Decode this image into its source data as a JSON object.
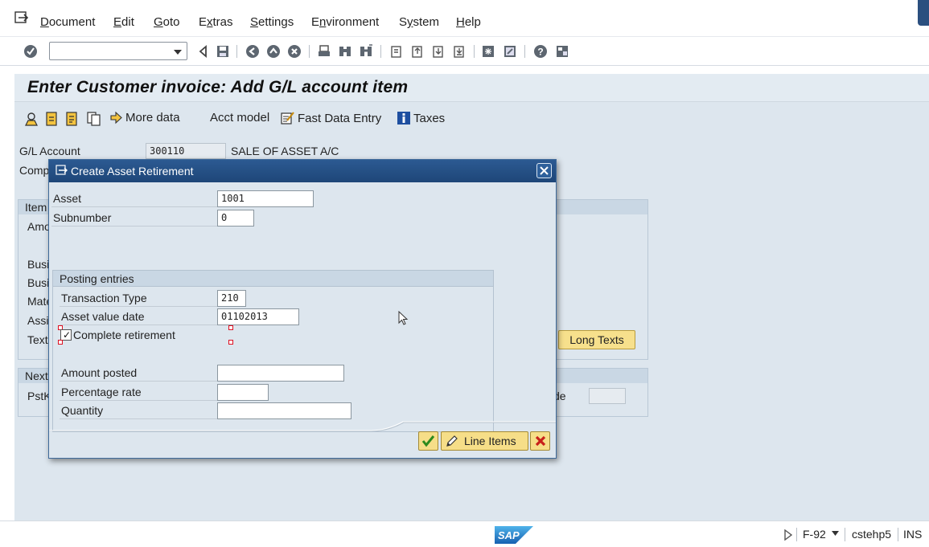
{
  "menubar": {
    "items": [
      "Document",
      "Edit",
      "Goto",
      "Extras",
      "Settings",
      "Environment",
      "System",
      "Help"
    ],
    "underline_chars": [
      "D",
      "E",
      "G",
      "x",
      "S",
      "n",
      "y",
      "H"
    ]
  },
  "toolbar": {
    "command_field_value": ""
  },
  "main": {
    "title": "Enter Customer invoice: Add G/L account item",
    "app_toolbar": {
      "more_data": "More data",
      "acct_model": "Acct model",
      "fast_data_entry": "Fast Data Entry",
      "taxes": "Taxes"
    },
    "gl_account_label": "G/L Account",
    "gl_account_value": "300110",
    "gl_account_desc": "SALE OF ASSET A/C",
    "company_label_partial": "Comp",
    "item_group_label_partial": "Item",
    "amount_label_partial": "Amo",
    "business_label_partial_1": "Busi",
    "business_label_partial_2": "Busi",
    "material_label_partial": "Mate",
    "assignment_label_partial": "Assi",
    "text_label_partial": "Text",
    "long_texts_button": "Long Texts",
    "next_group_label_partial": "Next",
    "pstk_label_partial": "PstK",
    "code_label_partial": "de"
  },
  "modal": {
    "title": "Create Asset Retirement",
    "asset_label": "Asset",
    "asset_value": "1001",
    "subnumber_label": "Subnumber",
    "subnumber_value": "0",
    "posting_group_label": "Posting entries",
    "transaction_type_label": "Transaction Type",
    "transaction_type_value": "210",
    "asset_value_date_label": "Asset value date",
    "asset_value_date_value": "01102013",
    "complete_retirement_label": "Complete retirement",
    "complete_retirement_checked": true,
    "amount_posted_label": "Amount posted",
    "amount_posted_value": "",
    "percentage_rate_label": "Percentage rate",
    "percentage_rate_value": "",
    "quantity_label": "Quantity",
    "quantity_value": "",
    "line_items_button": "Line Items"
  },
  "statusbar": {
    "transaction": "F-92",
    "system": "cstehp5",
    "mode": "INS"
  },
  "colors": {
    "modal_header": "#1e4678",
    "background": "#dde6ee",
    "button": "#f6de88",
    "accept_green": "#2d8a1e",
    "cancel_red": "#c8201a"
  }
}
